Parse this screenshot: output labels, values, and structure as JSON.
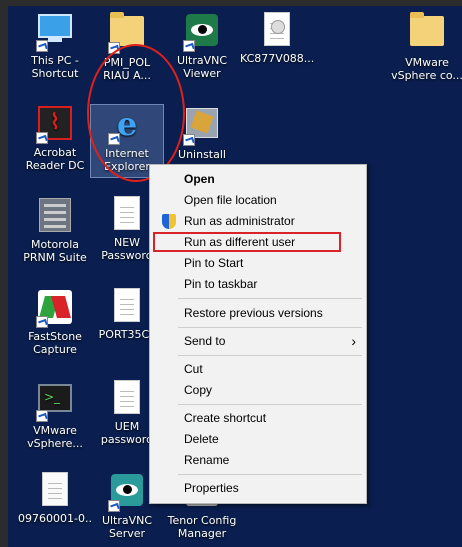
{
  "desktop": {
    "icons": [
      {
        "label": "This PC -\nShortcut"
      },
      {
        "label": "PMI_POL\nRIAU A..."
      },
      {
        "label": "UltraVNC\nViewer"
      },
      {
        "label": "KC877V088..."
      },
      {
        "label": "VMware\nvSphere co..."
      },
      {
        "label": "Acrobat\nReader DC"
      },
      {
        "label": "Internet\nExplorer"
      },
      {
        "label": "Uninstall"
      },
      {
        "label": "Motorola\nPRNM Suite"
      },
      {
        "label": "NEW\nPassword"
      },
      {
        "label": "FastStone\nCapture"
      },
      {
        "label": "PORT35CL"
      },
      {
        "label": "VMware\nvSphere..."
      },
      {
        "label": "UEM\npassword"
      },
      {
        "label": "09760001-0..."
      },
      {
        "label": "UltraVNC\nServer"
      },
      {
        "label": "Tenor Config\nManager"
      }
    ]
  },
  "context_menu": {
    "items": [
      {
        "label": "Open"
      },
      {
        "label": "Open file location"
      },
      {
        "label": "Run as administrator"
      },
      {
        "label": "Run as different user"
      },
      {
        "label": "Pin to Start"
      },
      {
        "label": "Pin to taskbar"
      },
      {
        "label": "Restore previous versions"
      },
      {
        "label": "Send to"
      },
      {
        "label": "Cut"
      },
      {
        "label": "Copy"
      },
      {
        "label": "Create shortcut"
      },
      {
        "label": "Delete"
      },
      {
        "label": "Rename"
      },
      {
        "label": "Properties"
      }
    ],
    "submenu_arrow": "›"
  },
  "colors": {
    "desktop_bg": "#0a1f4f",
    "annotation_red": "#e0201a"
  }
}
